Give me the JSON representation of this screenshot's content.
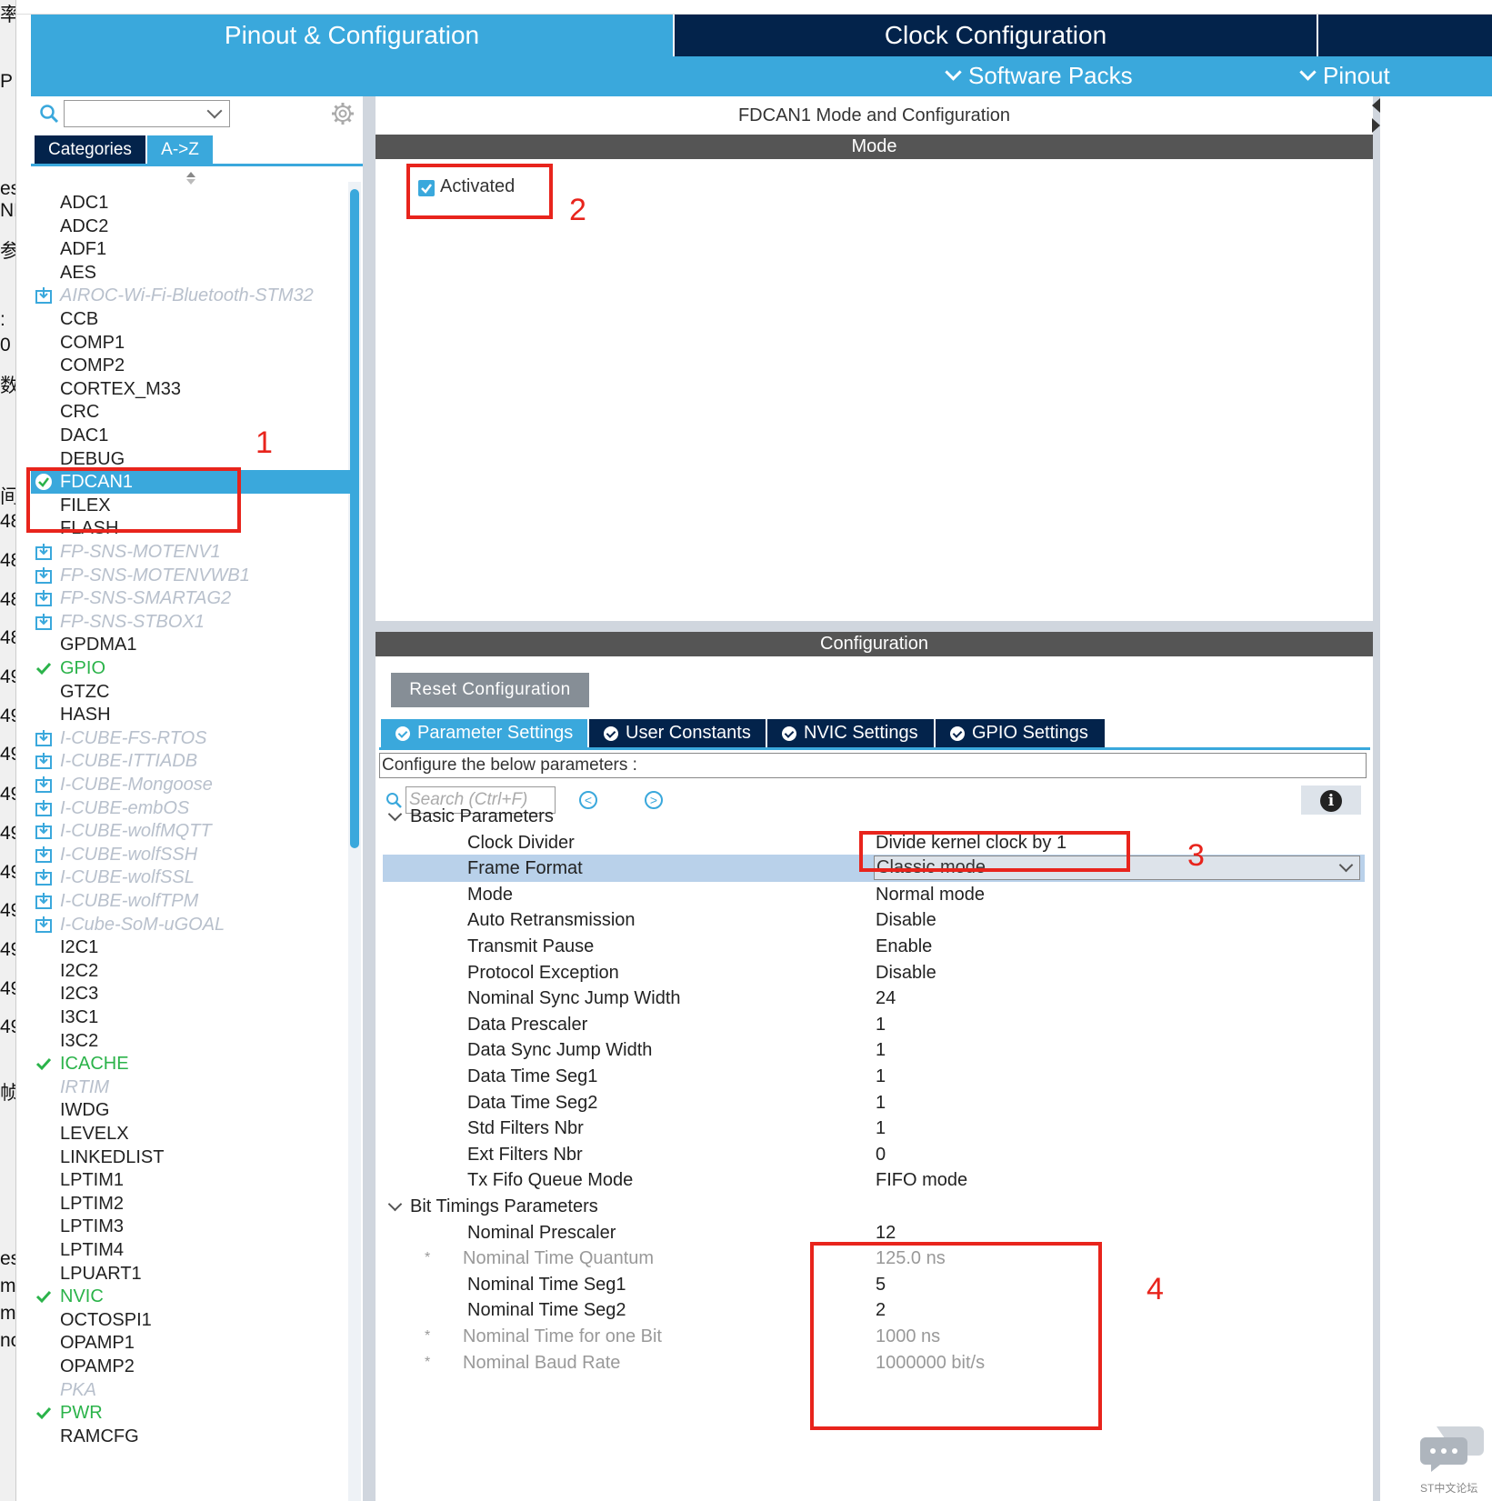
{
  "header": {
    "tab_pinout": "Pinout & Configuration",
    "tab_clock": "Clock Configuration",
    "menu_software_packs": "Software Packs",
    "menu_pinout": "Pinout"
  },
  "left_strip_glyphs": [
    "率",
    "P",
    "es",
    "NF",
    "参",
    ":",
    "0",
    "数",
    "间",
    "48",
    "48",
    "48",
    "48",
    "49",
    "49",
    "49",
    "49",
    "49",
    "49",
    "49",
    "49",
    "49",
    "49",
    "帧",
    "es",
    "me",
    "me",
    "nc"
  ],
  "sidebar": {
    "search_value": "",
    "tab_categories": "Categories",
    "tab_az": "A->Z",
    "items": [
      {
        "label": "ADC1",
        "state": "normal"
      },
      {
        "label": "ADC2",
        "state": "normal"
      },
      {
        "label": "ADF1",
        "state": "normal"
      },
      {
        "label": "AES",
        "state": "normal"
      },
      {
        "label": "AIROC-Wi-Fi-Bluetooth-STM32",
        "state": "pack"
      },
      {
        "label": "CCB",
        "state": "normal"
      },
      {
        "label": "COMP1",
        "state": "normal"
      },
      {
        "label": "COMP2",
        "state": "normal"
      },
      {
        "label": "CORTEX_M33",
        "state": "normal"
      },
      {
        "label": "CRC",
        "state": "normal"
      },
      {
        "label": "DAC1",
        "state": "normal"
      },
      {
        "label": "DEBUG",
        "state": "normal"
      },
      {
        "label": "FDCAN1",
        "state": "selected"
      },
      {
        "label": "FILEX",
        "state": "normal"
      },
      {
        "label": "FLASH",
        "state": "normal"
      },
      {
        "label": "FP-SNS-MOTENV1",
        "state": "pack"
      },
      {
        "label": "FP-SNS-MOTENVWB1",
        "state": "pack"
      },
      {
        "label": "FP-SNS-SMARTAG2",
        "state": "pack"
      },
      {
        "label": "FP-SNS-STBOX1",
        "state": "pack"
      },
      {
        "label": "GPDMA1",
        "state": "normal"
      },
      {
        "label": "GPIO",
        "state": "configured"
      },
      {
        "label": "GTZC",
        "state": "normal"
      },
      {
        "label": "HASH",
        "state": "normal"
      },
      {
        "label": "I-CUBE-FS-RTOS",
        "state": "pack"
      },
      {
        "label": "I-CUBE-ITTIADB",
        "state": "pack"
      },
      {
        "label": "I-CUBE-Mongoose",
        "state": "pack"
      },
      {
        "label": "I-CUBE-embOS",
        "state": "pack"
      },
      {
        "label": "I-CUBE-wolfMQTT",
        "state": "pack"
      },
      {
        "label": "I-CUBE-wolfSSH",
        "state": "pack"
      },
      {
        "label": "I-CUBE-wolfSSL",
        "state": "pack"
      },
      {
        "label": "I-CUBE-wolfTPM",
        "state": "pack"
      },
      {
        "label": "I-Cube-SoM-uGOAL",
        "state": "pack"
      },
      {
        "label": "I2C1",
        "state": "normal"
      },
      {
        "label": "I2C2",
        "state": "normal"
      },
      {
        "label": "I2C3",
        "state": "normal"
      },
      {
        "label": "I3C1",
        "state": "normal"
      },
      {
        "label": "I3C2",
        "state": "normal"
      },
      {
        "label": "ICACHE",
        "state": "configured"
      },
      {
        "label": "IRTIM",
        "state": "disabled"
      },
      {
        "label": "IWDG",
        "state": "normal"
      },
      {
        "label": "LEVELX",
        "state": "normal"
      },
      {
        "label": "LINKEDLIST",
        "state": "normal"
      },
      {
        "label": "LPTIM1",
        "state": "normal"
      },
      {
        "label": "LPTIM2",
        "state": "normal"
      },
      {
        "label": "LPTIM3",
        "state": "normal"
      },
      {
        "label": "LPTIM4",
        "state": "normal"
      },
      {
        "label": "LPUART1",
        "state": "normal"
      },
      {
        "label": "NVIC",
        "state": "configured"
      },
      {
        "label": "OCTOSPI1",
        "state": "normal"
      },
      {
        "label": "OPAMP1",
        "state": "normal"
      },
      {
        "label": "OPAMP2",
        "state": "normal"
      },
      {
        "label": "PKA",
        "state": "disabled"
      },
      {
        "label": "PWR",
        "state": "configured"
      },
      {
        "label": "RAMCFG",
        "state": "normal"
      }
    ]
  },
  "main": {
    "title": "FDCAN1 Mode and Configuration",
    "mode_header": "Mode",
    "activated_label": "Activated",
    "activated_checked": true,
    "config_header": "Configuration",
    "reset_button": "Reset Configuration",
    "tabs": [
      {
        "label": "Parameter Settings",
        "active": true
      },
      {
        "label": "User Constants",
        "active": false
      },
      {
        "label": "NVIC Settings",
        "active": false
      },
      {
        "label": "GPIO Settings",
        "active": false
      }
    ],
    "configure_text": "Configure the below parameters :",
    "search_placeholder": "Search (Ctrl+F)",
    "info_icon_text": "i",
    "nav_prev": "<",
    "nav_next": ">",
    "groups": [
      {
        "title": "Basic Parameters",
        "params": [
          {
            "name": "Clock Divider",
            "value": "Divide kernel clock by 1",
            "readonly": false
          },
          {
            "name": "Frame Format",
            "value": "Classic mode",
            "readonly": false,
            "dropdown": true
          },
          {
            "name": "Mode",
            "value": "Normal mode",
            "readonly": false
          },
          {
            "name": "Auto Retransmission",
            "value": "Disable",
            "readonly": false
          },
          {
            "name": "Transmit Pause",
            "value": "Enable",
            "readonly": false
          },
          {
            "name": "Protocol Exception",
            "value": "Disable",
            "readonly": false
          },
          {
            "name": "Nominal Sync Jump Width",
            "value": "24",
            "readonly": false
          },
          {
            "name": "Data Prescaler",
            "value": "1",
            "readonly": false
          },
          {
            "name": "Data Sync Jump Width",
            "value": "1",
            "readonly": false
          },
          {
            "name": "Data Time Seg1",
            "value": "1",
            "readonly": false
          },
          {
            "name": "Data Time Seg2",
            "value": "1",
            "readonly": false
          },
          {
            "name": "Std Filters Nbr",
            "value": "1",
            "readonly": false
          },
          {
            "name": "Ext Filters Nbr",
            "value": "0",
            "readonly": false
          },
          {
            "name": "Tx Fifo Queue Mode",
            "value": "FIFO mode",
            "readonly": false
          }
        ]
      },
      {
        "title": "Bit Timings Parameters",
        "params": [
          {
            "name": "Nominal Prescaler",
            "value": "12",
            "readonly": false
          },
          {
            "name": "Nominal Time Quantum",
            "value": "125.0 ns",
            "readonly": true
          },
          {
            "name": "Nominal Time Seg1",
            "value": "5",
            "readonly": false
          },
          {
            "name": "Nominal Time Seg2",
            "value": "2",
            "readonly": false
          },
          {
            "name": "Nominal Time for one Bit",
            "value": "1000 ns",
            "readonly": true
          },
          {
            "name": "Nominal Baud Rate",
            "value": "1000000 bit/s",
            "readonly": true
          }
        ]
      }
    ],
    "readonly_marker": "*"
  },
  "annotations": [
    "1",
    "2",
    "3",
    "4"
  ],
  "watermark": "ST中文论坛",
  "colors": {
    "accent": "#3aa8dc",
    "navy": "#03234b",
    "configured": "#2bb34a",
    "annotation": "#e8241c",
    "pack": "#b8c0cc"
  }
}
